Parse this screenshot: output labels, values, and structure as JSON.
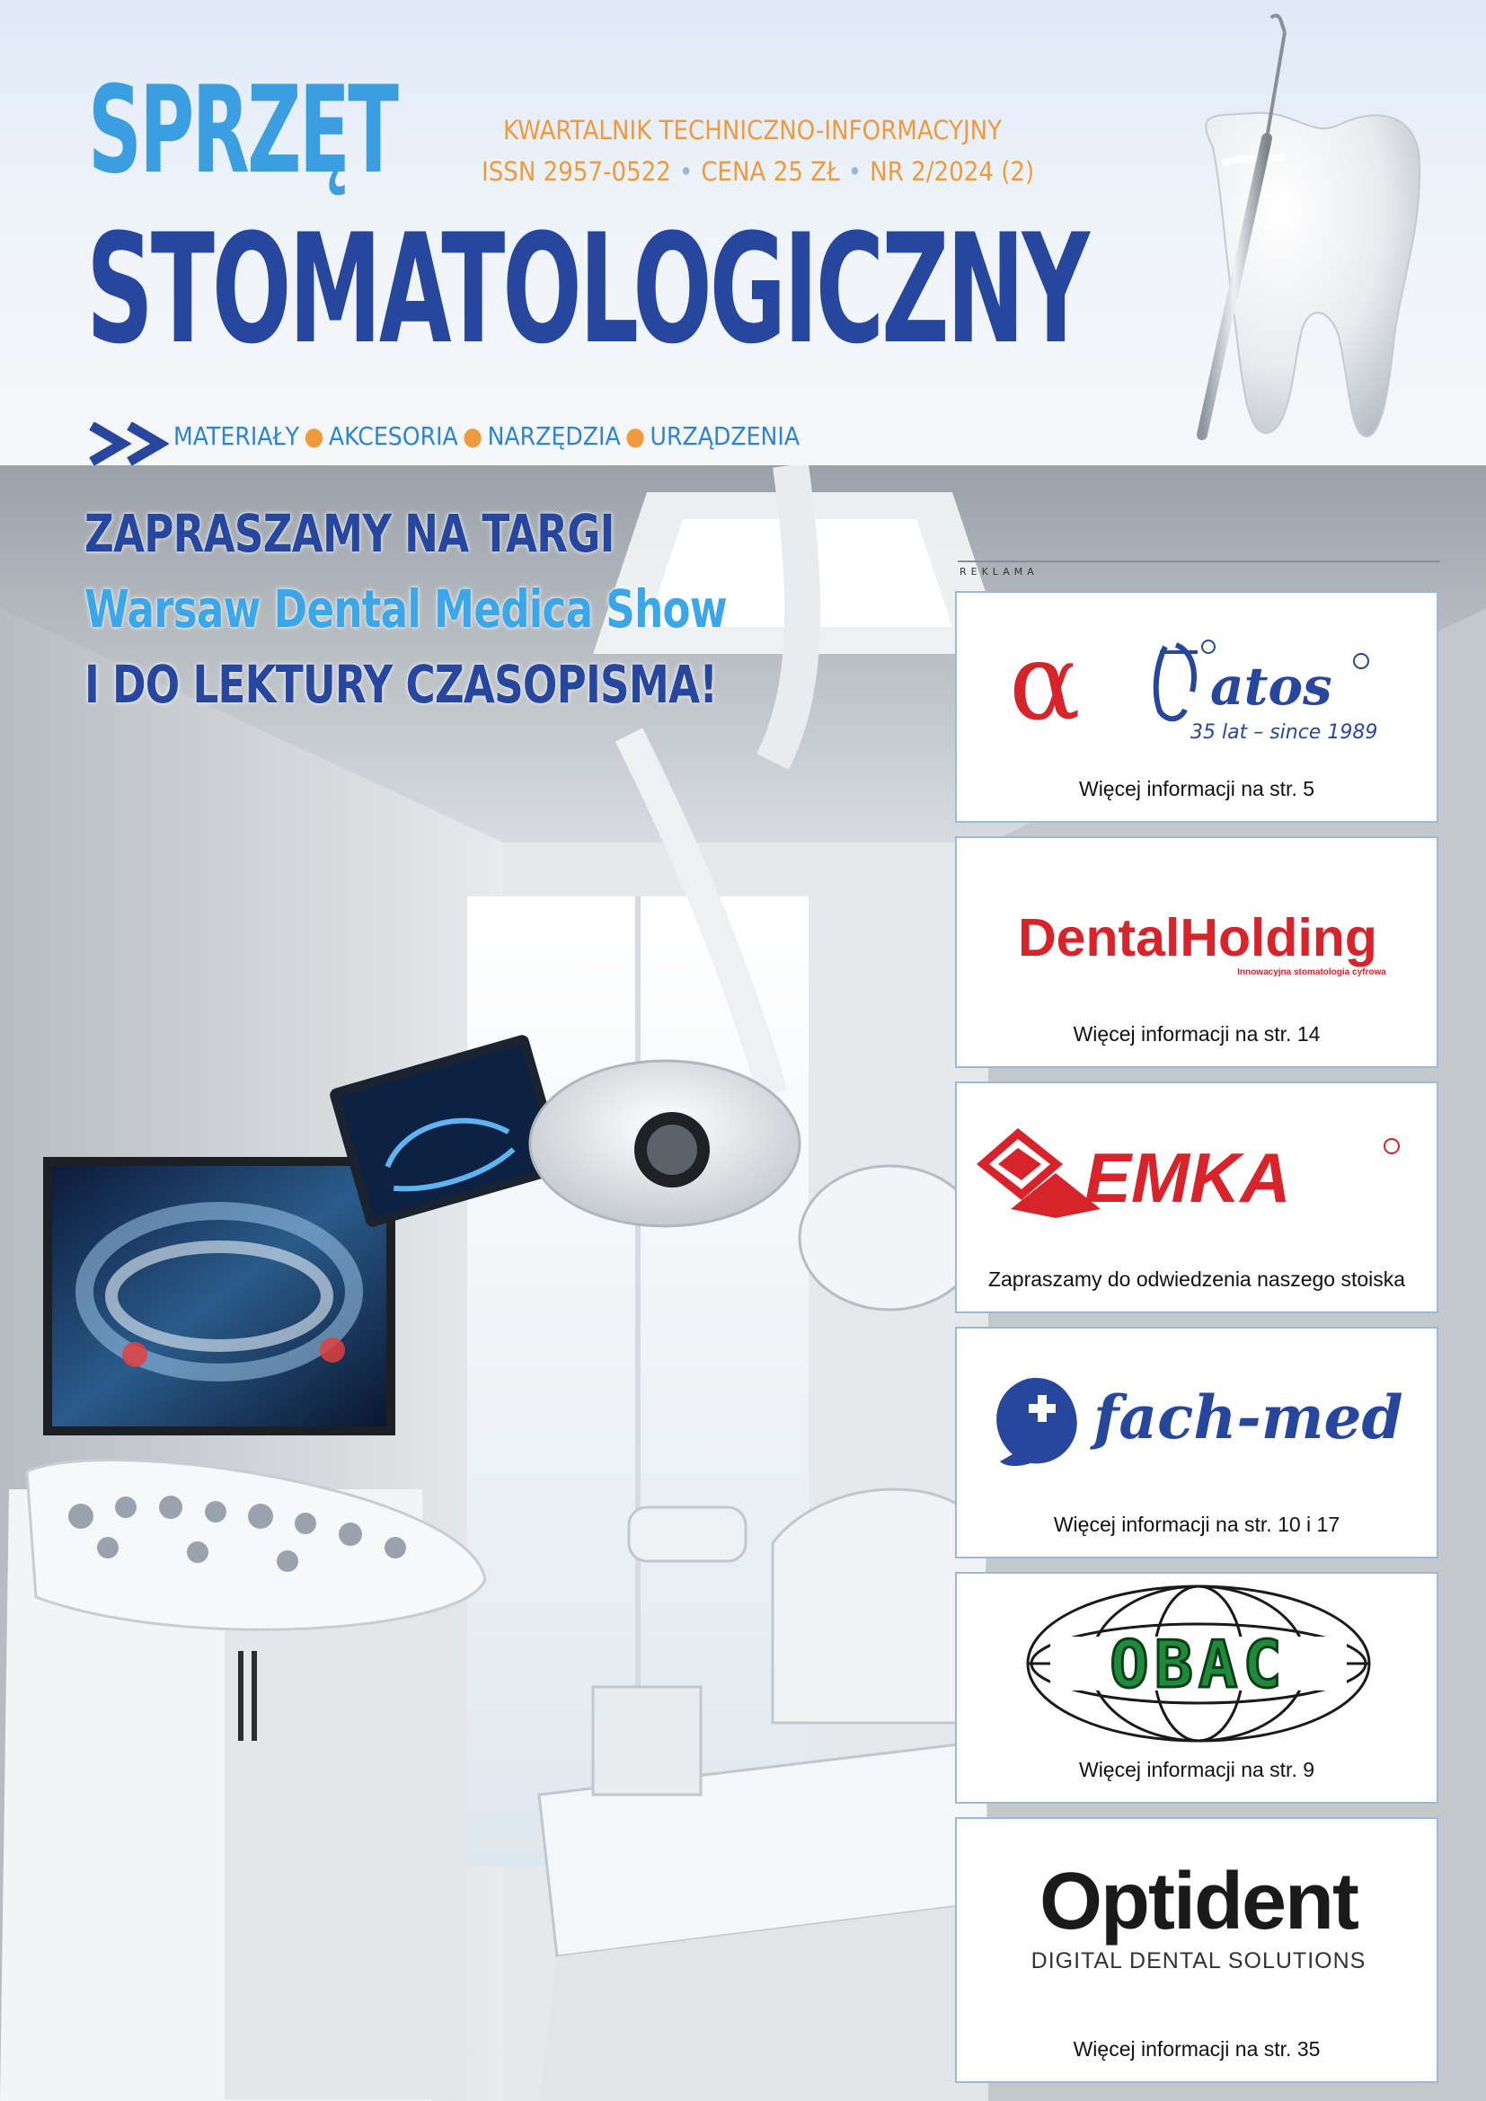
{
  "header": {
    "title_line1": "SPRZĘT",
    "title_line2": "STOMATOLOGICZNY",
    "kwartalnik": "KWARTALNIK TECHNICZNO-INFORMACYJNY",
    "issn": "ISSN 2957-0522",
    "price": "CENA 25 ZŁ",
    "issue": "NR 2/2024 (2)",
    "categories": [
      "MATERIAŁY",
      "AKCESORIA",
      "NARZĘDZIA",
      "URZĄDZENIA"
    ]
  },
  "headline": {
    "line1": "ZAPRASZAMY NA TARGI",
    "line2": "Warsaw Dental Medica Show",
    "line3": "I DO LEKTURY CZASOPISMA!"
  },
  "ads": {
    "section_label": "REKLAMA",
    "items": [
      {
        "brand": "atos",
        "logo_text": "atos",
        "tagline": "35 lat – since 1989",
        "caption": "Więcej informacji na str. 5"
      },
      {
        "brand": "DentalHolding",
        "logo_text": "DentalHolding",
        "tagline": "Innowacyjna stomatologia cyfrowa",
        "caption": "Więcej informacji na str. 14"
      },
      {
        "brand": "EMKA",
        "logo_text": "EMKA",
        "caption": "Zapraszamy do odwiedzenia naszego stoiska"
      },
      {
        "brand": "fach-med",
        "logo_text": "fach-med",
        "caption": "Więcej informacji na str. 10 i 17"
      },
      {
        "brand": "OBAC",
        "logo_text": "OBAC",
        "caption": "Więcej informacji na str. 9"
      },
      {
        "brand": "Optident",
        "logo_text": "Optident",
        "tagline": "DIGITAL DENTAL SOLUTIONS",
        "caption": "Więcej informacji na str. 35"
      }
    ]
  },
  "colors": {
    "navy": "#27479e",
    "sky": "#3b9ee0",
    "orange": "#ef9a3c",
    "ad_red": "#d8232a"
  },
  "icons": [
    "double-chevron-icon",
    "tooth-probe-illustration",
    "alpha-symbol-icon",
    "plus-drop-icon",
    "globe-icon"
  ]
}
